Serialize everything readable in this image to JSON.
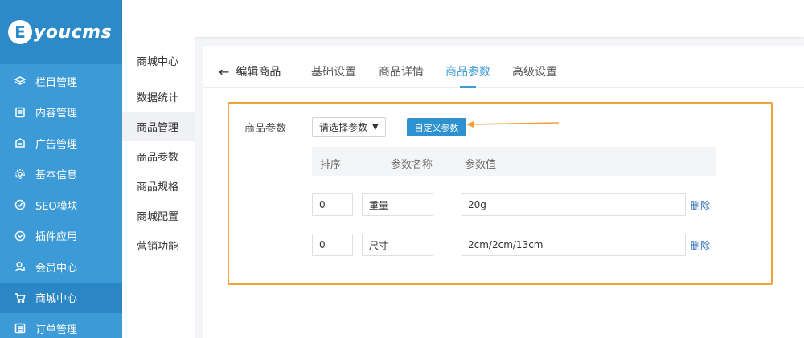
{
  "brand": {
    "logo_letter": "E",
    "name": "youcms"
  },
  "sidebar": {
    "items": [
      {
        "label": "栏目管理",
        "icon": "layers-icon"
      },
      {
        "label": "内容管理",
        "icon": "document-icon"
      },
      {
        "label": "广告管理",
        "icon": "ad-icon"
      },
      {
        "label": "基本信息",
        "icon": "gear-icon"
      },
      {
        "label": "SEO模块",
        "icon": "seo-icon"
      },
      {
        "label": "插件应用",
        "icon": "plugin-icon"
      },
      {
        "label": "会员中心",
        "icon": "user-icon"
      },
      {
        "label": "商城中心",
        "icon": "cart-icon"
      },
      {
        "label": "订单管理",
        "icon": "order-icon"
      }
    ],
    "active_index": 7
  },
  "submenu": {
    "title": "商城中心",
    "items": [
      "数据统计",
      "商品管理",
      "商品参数",
      "商品规格",
      "商城配置",
      "营销功能"
    ],
    "active_index": 1
  },
  "header": {
    "back_arrow": "←",
    "page_title": "编辑商品",
    "tabs": [
      "基础设置",
      "商品详情",
      "商品参数",
      "高级设置"
    ],
    "active_tab": 2
  },
  "form": {
    "param_label": "商品参数",
    "select_value": "请选择参数",
    "custom_button": "自定义参数",
    "columns": [
      "排序",
      "参数名称",
      "参数值"
    ],
    "rows": [
      {
        "order": "0",
        "name": "重量",
        "value": "20g",
        "action": "删除"
      },
      {
        "order": "0",
        "name": "尺寸",
        "value": "2cm/2cm/13cm",
        "action": "删除"
      }
    ]
  },
  "colors": {
    "accent": "#3c9ad6",
    "sidebar": "#3c9ad6",
    "highlight": "#f0a03c",
    "button": "#2e92d1"
  }
}
